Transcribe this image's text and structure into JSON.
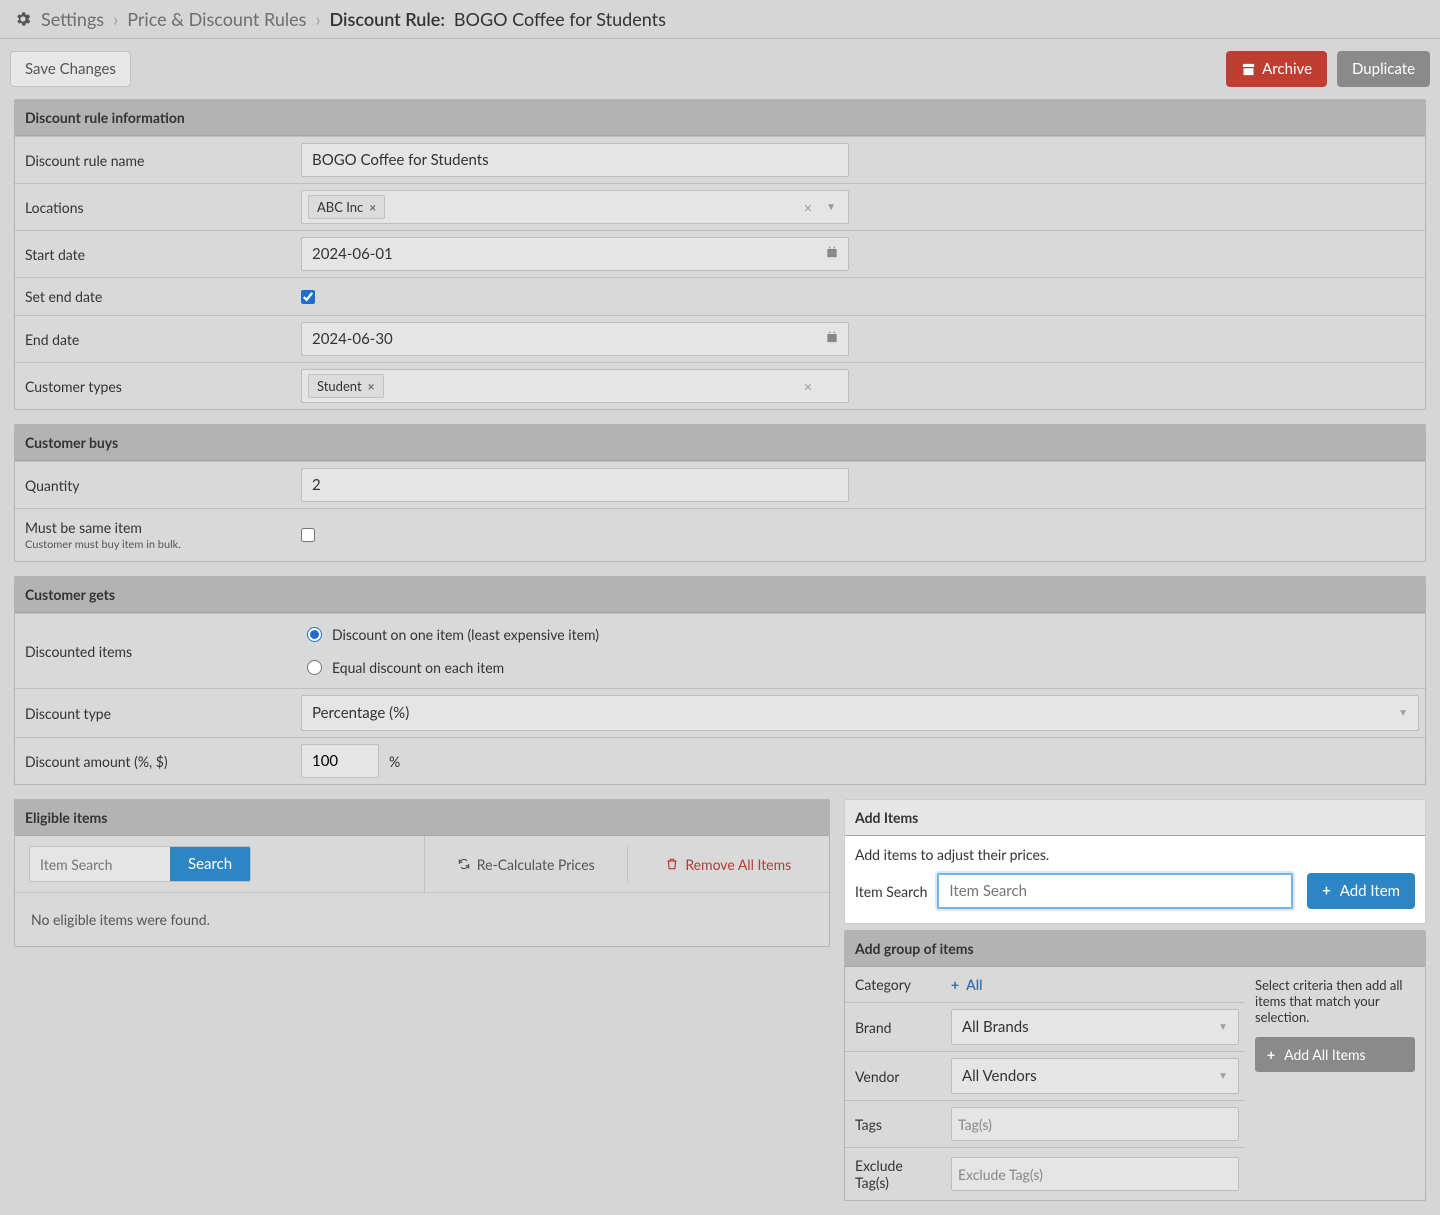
{
  "breadcrumb": {
    "settings": "Settings",
    "rules": "Price & Discount Rules",
    "label": "Discount Rule:",
    "value": "BOGO Coffee for Students"
  },
  "actions": {
    "save": "Save Changes",
    "archive": "Archive",
    "duplicate": "Duplicate"
  },
  "info": {
    "title": "Discount rule information",
    "fields": {
      "name_label": "Discount rule name",
      "name_value": "BOGO Coffee for Students",
      "locations_label": "Locations",
      "locations_chip": "ABC Inc",
      "start_label": "Start date",
      "start_value": "2024-06-01",
      "setend_label": "Set end date",
      "end_label": "End date",
      "end_value": "2024-06-30",
      "ctype_label": "Customer types",
      "ctype_chip": "Student"
    }
  },
  "buys": {
    "title": "Customer buys",
    "qty_label": "Quantity",
    "qty_value": "2",
    "same_label": "Must be same item",
    "same_sub": "Customer must buy item in bulk."
  },
  "gets": {
    "title": "Customer gets",
    "discounted_label": "Discounted items",
    "radio_one": "Discount on one item (least expensive item)",
    "radio_equal": "Equal discount on each item",
    "dtype_label": "Discount type",
    "dtype_value": "Percentage   (%)",
    "damount_label": "Discount amount (%, $)",
    "damount_value": "100",
    "pct": "%"
  },
  "eligible": {
    "title": "Eligible items",
    "search_ph": "Item Search",
    "search_btn": "Search",
    "recalc": "Re-Calculate Prices",
    "remove": "Remove All Items",
    "none": "No eligible items were found."
  },
  "additems": {
    "title": "Add Items",
    "desc": "Add items to adjust their prices.",
    "search_label": "Item Search",
    "search_ph": "Item Search",
    "add_btn": "Add Item"
  },
  "group": {
    "title": "Add group of items",
    "category_label": "Category",
    "category_all": "All",
    "brand_label": "Brand",
    "brand_value": "All Brands",
    "vendor_label": "Vendor",
    "vendor_value": "All Vendors",
    "tags_label": "Tags",
    "tags_ph": "Tag(s)",
    "extags_label": "Exclude Tag(s)",
    "extags_ph": "Exclude Tag(s)",
    "aside_text": "Select criteria then add all items that match your selection.",
    "add_all": "Add All Items"
  }
}
